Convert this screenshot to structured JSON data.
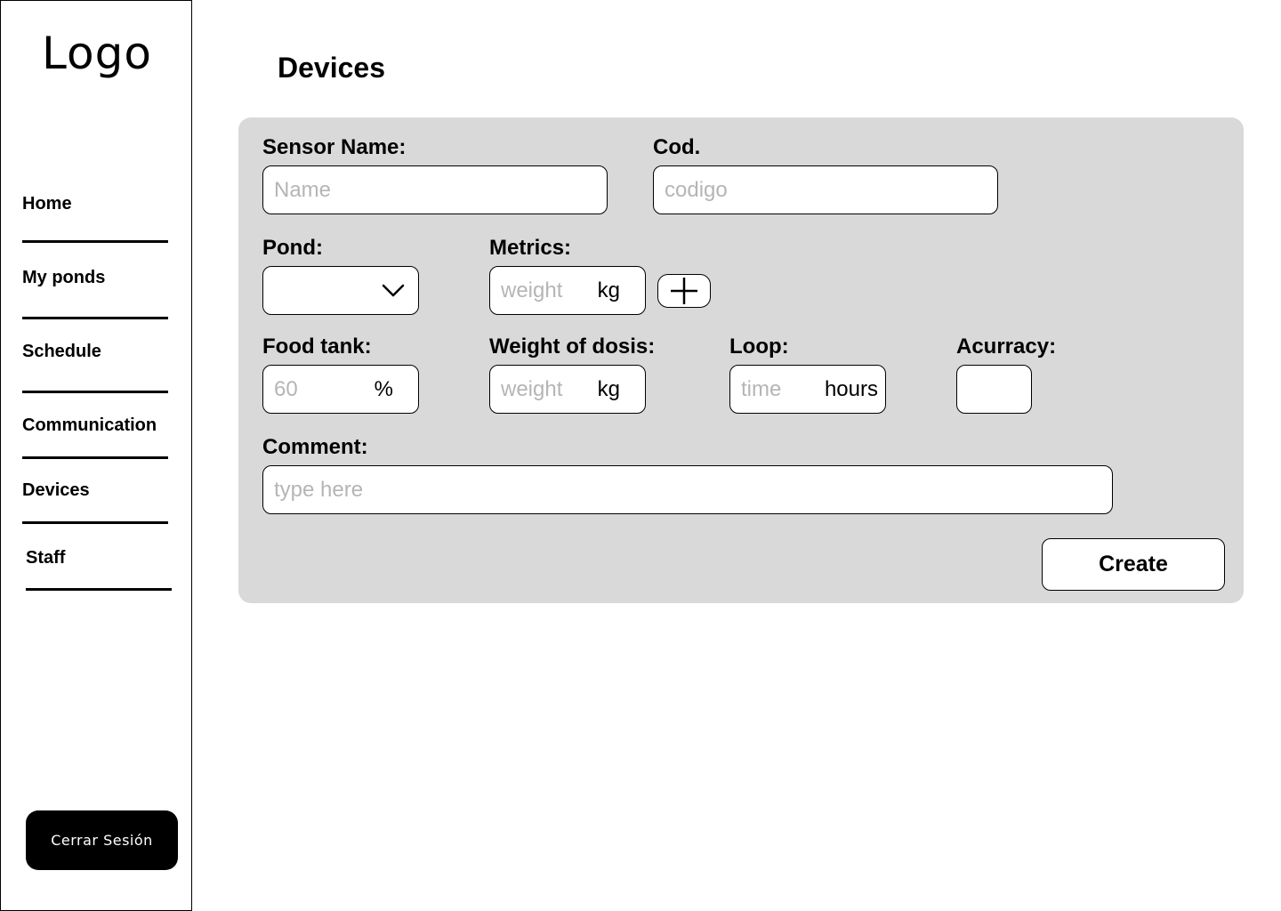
{
  "sidebar": {
    "logo": "Logo",
    "items": [
      {
        "label": "Home"
      },
      {
        "label": "My ponds"
      },
      {
        "label": "Schedule"
      },
      {
        "label": "Communication"
      },
      {
        "label": "Devices"
      },
      {
        "label": "Staff"
      }
    ],
    "logout_label": "Cerrar Sesión"
  },
  "main": {
    "title": "Devices",
    "form": {
      "sensor_name": {
        "label": "Sensor Name:",
        "placeholder": "Name",
        "value": ""
      },
      "cod": {
        "label": "Cod.",
        "placeholder": "codigo",
        "value": ""
      },
      "pond": {
        "label": "Pond:",
        "selected": ""
      },
      "metrics": {
        "label": "Metrics:",
        "placeholder": "weight",
        "unit": "kg",
        "add_icon": "plus-icon"
      },
      "food_tank": {
        "label": "Food tank:",
        "placeholder": "60",
        "unit": "%"
      },
      "weight_of_dosis": {
        "label": "Weight of dosis:",
        "placeholder": "weight",
        "unit": "kg"
      },
      "loop": {
        "label": "Loop:",
        "placeholder": "time",
        "unit": "hours"
      },
      "accuracy": {
        "label": "Acurracy:",
        "value": ""
      },
      "comment": {
        "label": "Comment:",
        "placeholder": "type here"
      },
      "create_label": "Create"
    }
  },
  "colors": {
    "panel_bg": "#d9d9d9",
    "placeholder": "#b5b5b5",
    "logout_bg": "#000000"
  }
}
